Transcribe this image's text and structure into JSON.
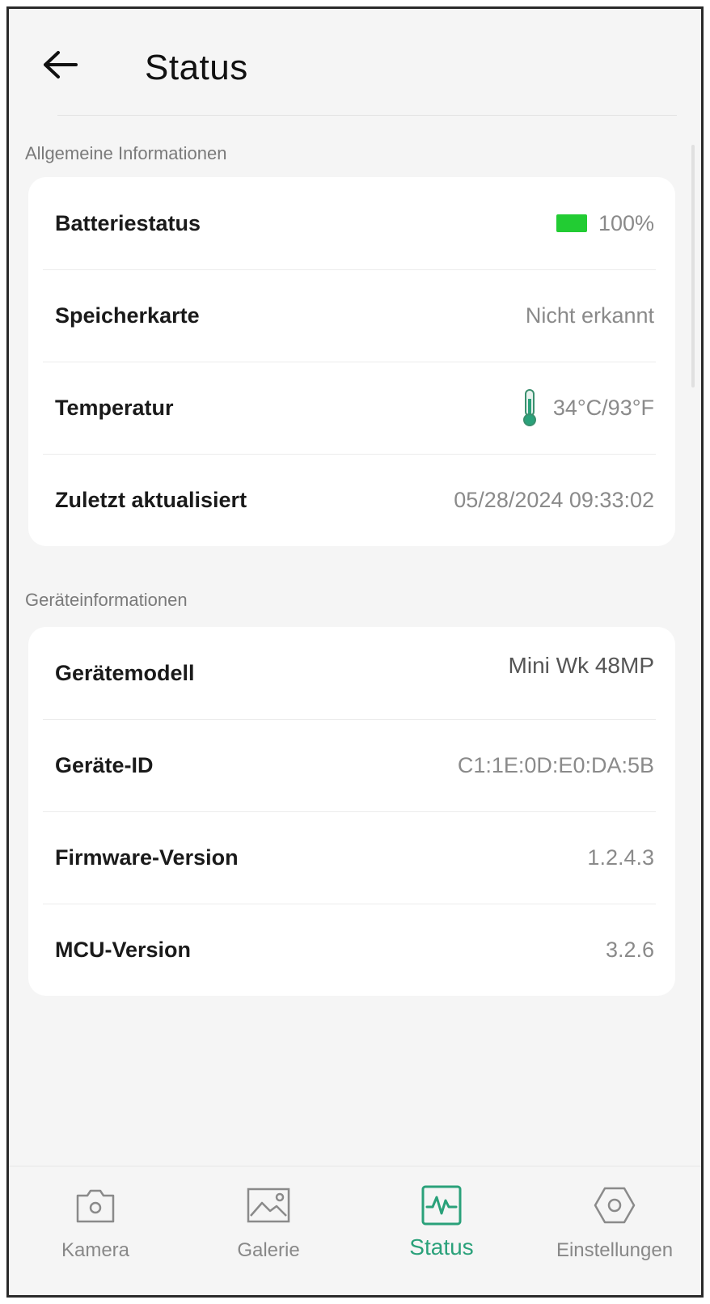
{
  "header": {
    "title": "Status"
  },
  "sections": [
    {
      "label": "Allgemeine Informationen",
      "rows": [
        {
          "label": "Batteriestatus",
          "value": "100%",
          "icon": "battery-icon"
        },
        {
          "label": "Speicherkarte",
          "value": "Nicht erkannt"
        },
        {
          "label": "Temperatur",
          "value": "34°C/93°F",
          "icon": "thermometer-icon"
        },
        {
          "label": "Zuletzt aktualisiert",
          "value": "05/28/2024 09:33:02"
        }
      ]
    },
    {
      "label": "Geräteinformationen",
      "rows": [
        {
          "label": "Gerätemodell",
          "value": "Mini Wk 48MP"
        },
        {
          "label": "Geräte-ID",
          "value": "C1:1E:0D:E0:DA:5B"
        },
        {
          "label": "Firmware-Version",
          "value": "1.2.4.3"
        },
        {
          "label": "MCU-Version",
          "value": "3.2.6"
        }
      ]
    }
  ],
  "nav": {
    "items": [
      {
        "label": "Kamera",
        "icon": "camera-icon"
      },
      {
        "label": "Galerie",
        "icon": "gallery-icon"
      },
      {
        "label": "Status",
        "icon": "status-icon",
        "active": true
      },
      {
        "label": "Einstellungen",
        "icon": "settings-icon"
      }
    ]
  },
  "colors": {
    "accent": "#2aa17a",
    "battery": "#22cc33",
    "background": "#f5f5f5",
    "card": "#ffffff"
  }
}
